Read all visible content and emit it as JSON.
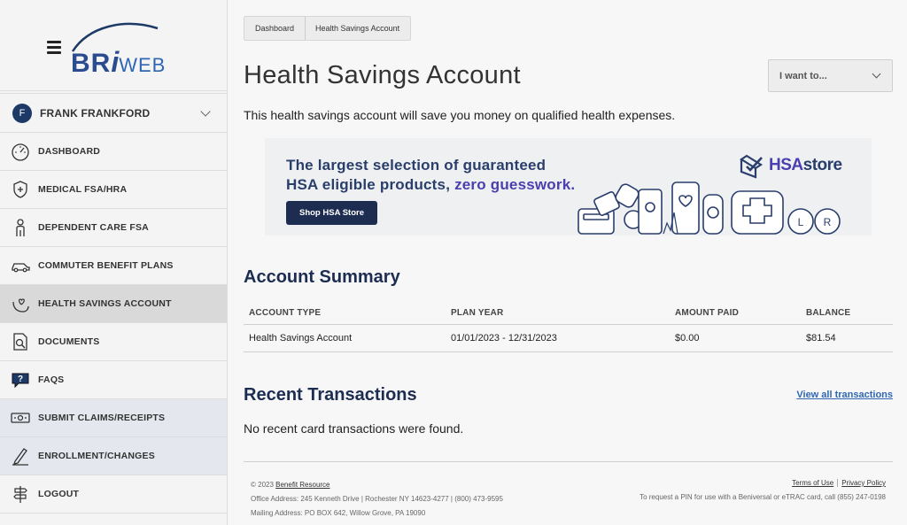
{
  "logo": {
    "part1": "BR",
    "part2": "i",
    "part3": "WEB"
  },
  "user": {
    "initial": "F",
    "name": "FRANK FRANKFORD"
  },
  "nav": [
    {
      "label": "DASHBOARD",
      "icon": "gauge-icon"
    },
    {
      "label": "MEDICAL FSA/HRA",
      "icon": "medical-shield-icon"
    },
    {
      "label": "DEPENDENT CARE FSA",
      "icon": "person-icon"
    },
    {
      "label": "COMMUTER BENEFIT PLANS",
      "icon": "car-icon"
    },
    {
      "label": "HEALTH SAVINGS ACCOUNT",
      "icon": "hand-heart-icon"
    },
    {
      "label": "DOCUMENTS",
      "icon": "document-search-icon"
    },
    {
      "label": "FAQS",
      "icon": "question-bubble-icon"
    },
    {
      "label": "SUBMIT CLAIMS/RECEIPTS",
      "icon": "receipt-icon"
    },
    {
      "label": "ENROLLMENT/CHANGES",
      "icon": "pen-icon"
    },
    {
      "label": "LOGOUT",
      "icon": "signpost-icon"
    }
  ],
  "breadcrumb": {
    "first": "Dashboard",
    "second": "Health Savings Account"
  },
  "page": {
    "title": "Health Savings Account",
    "subtitle": "This health savings account will save you money on qualified health expenses.",
    "iwant": "I want to..."
  },
  "banner": {
    "line1": "The largest selection of guaranteed",
    "line2a": "HSA eligible products, ",
    "line2b": "zero guesswork.",
    "button": "Shop HSA Store",
    "logo_hsa": "HSA",
    "logo_store": "store"
  },
  "summary": {
    "title": "Account Summary",
    "headers": [
      "ACCOUNT TYPE",
      "PLAN YEAR",
      "AMOUNT PAID",
      "BALANCE"
    ],
    "row": [
      "Health Savings Account",
      "01/01/2023 - 12/31/2023",
      "$0.00",
      "$81.54"
    ]
  },
  "transactions": {
    "title": "Recent Transactions",
    "view_all": "View all transactions",
    "empty": "No recent card transactions were found."
  },
  "footer": {
    "copyright": "© 2023 ",
    "company": "Benefit Resource",
    "office": "Office Address: 245 Kenneth Drive | Rochester NY 14623-4277 | (800) 473-9595",
    "mailing": "Mailing Address: PO BOX 642, Willow Grove, PA 19090",
    "terms": "Terms of Use",
    "privacy": "Privacy Policy",
    "pin_note": "To request a PIN for use with a Beniversal or eTRAC card, call (855) 247-0198"
  },
  "colors": {
    "navy": "#1d2d52",
    "link": "#2f66b3",
    "accent": "#4b3fb0"
  }
}
